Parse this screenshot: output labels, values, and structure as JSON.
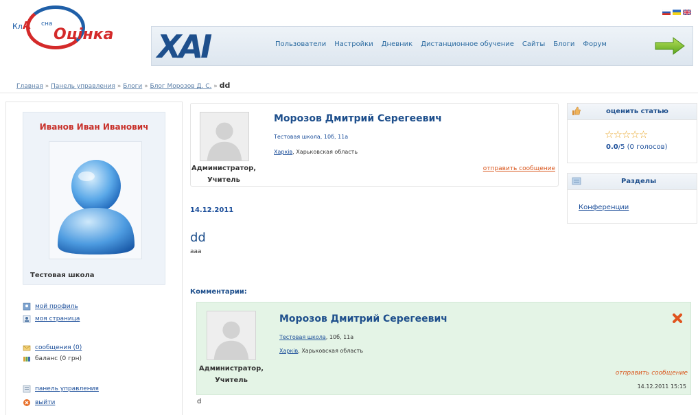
{
  "header": {
    "logo_prefix": "Кл",
    "logo_letter": "А",
    "logo_sup": "сна",
    "logo_main": "Оцінка",
    "brand": "ХАІ",
    "nav": [
      "Пользователи",
      "Настройки",
      "Дневник",
      "Дистанционное обучение",
      "Сайты",
      "Блоги",
      "Форум"
    ],
    "flags": [
      "ru-flag",
      "ua-flag",
      "uk-flag"
    ]
  },
  "breadcrumb": {
    "items": [
      "Главная",
      "Панель управления",
      "Блоги",
      "Блог Морозов Д. С."
    ],
    "separator": "»",
    "current": "dd"
  },
  "sidebar": {
    "user_name": "Иванов Иван Иванович",
    "school": "Тестовая школа",
    "menu": [
      {
        "label": "мой профиль",
        "icon": "profile-icon",
        "link": true
      },
      {
        "label": "моя страница",
        "icon": "page-icon",
        "link": true
      },
      {
        "label": "сообщения (0)",
        "icon": "mail-icon",
        "link": true
      },
      {
        "label": "баланс (0 грн)",
        "icon": "balance-icon",
        "link": false
      },
      {
        "label": "панель управления",
        "icon": "panel-icon",
        "link": true
      },
      {
        "label": "выйти",
        "icon": "exit-icon",
        "link": true
      }
    ]
  },
  "author": {
    "name": "Морозов Дмитрий Серегеевич",
    "school_line": "Тестовая школа, 10б, 11а",
    "city": "Харків",
    "region": ", Харьковская область",
    "role_line1": "Администратор,",
    "role_line2": "Учитель",
    "send_message": "отправить сообщение"
  },
  "post": {
    "date": "14.12.2011",
    "title": "dd",
    "body": "ааа"
  },
  "comments": {
    "heading": "Комментарии:",
    "items": [
      {
        "author": "Морозов Дмитрий Серегеевич",
        "school": "Тестовая школа",
        "school_rest": ", 10б, 11а",
        "city": "Харків",
        "region": ", Харьковская область",
        "role_line1": "Администратор,",
        "role_line2": "Учитель",
        "send_message": "отправить сообщение",
        "datetime": "14.12.2011 15:15",
        "text": "d"
      }
    ]
  },
  "rating": {
    "title": "оценить статью",
    "value": "0.0",
    "rest": "/5 (0 голосов)",
    "stars": "☆☆☆☆☆"
  },
  "sections": {
    "title": "Разделы",
    "link": "Конференции"
  },
  "colors": {
    "accent_blue": "#1e4f8c",
    "name_red": "#c8312b",
    "orange_link": "#d9561c",
    "comment_bg": "#e4f4e6"
  }
}
